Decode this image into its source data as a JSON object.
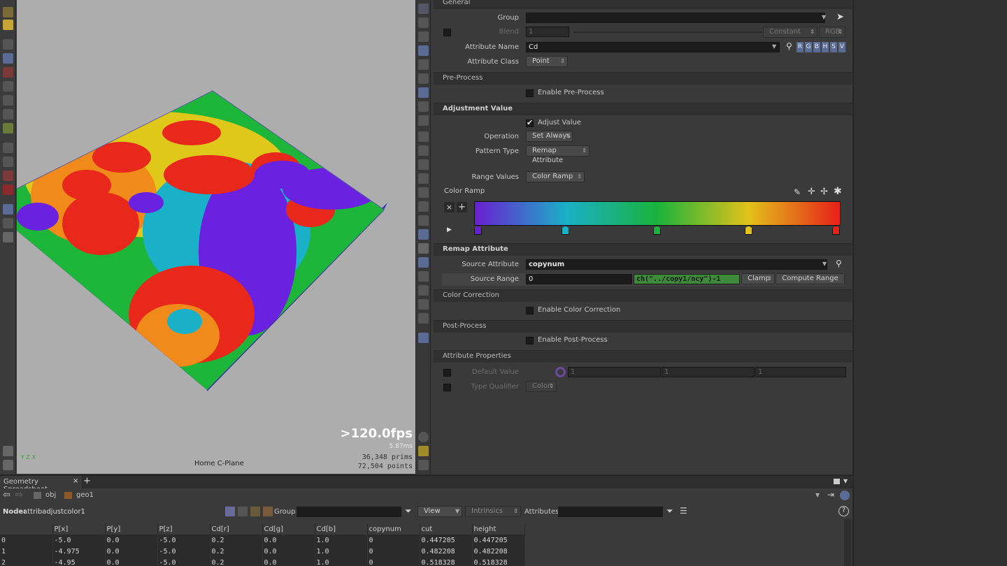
{
  "viewport": {
    "fps": ">120.0fps",
    "ms": "5.87ms",
    "prims_count": "36,348",
    "prims_label": "prims",
    "points_count": "72,504",
    "points_label": "points",
    "cplane": "Home C-Plane",
    "axis_label": "Y Z X"
  },
  "params": {
    "general": {
      "title": "General",
      "group_label": "Group",
      "group_value": "",
      "blend_label": "Blend",
      "blend_value": "1",
      "blend_mode": "Constant",
      "blend_space": "RGB",
      "attr_name_label": "Attribute Name",
      "attr_name_value": "Cd",
      "rgb_buttons": [
        "R",
        "G",
        "B",
        "H",
        "S",
        "V"
      ],
      "attr_class_label": "Attribute Class",
      "attr_class_value": "Point"
    },
    "preprocess": {
      "title": "Pre-Process",
      "enable_label": "Enable Pre-Process"
    },
    "adjustment": {
      "title": "Adjustment Value",
      "adjust_label": "Adjust Value",
      "operation_label": "Operation",
      "operation_value": "Set Always",
      "pattern_label": "Pattern Type",
      "pattern_value": "Remap Attribute",
      "range_label": "Range Values",
      "range_value": "Color Ramp",
      "ramp_label": "Color Ramp",
      "ramp_keys": [
        {
          "pos": 0.0,
          "color": "#6a1fd1"
        },
        {
          "pos": 0.25,
          "color": "#1ab0c8"
        },
        {
          "pos": 0.5,
          "color": "#19b33c"
        },
        {
          "pos": 0.75,
          "color": "#e2c21b"
        },
        {
          "pos": 1.0,
          "color": "#e8201a"
        }
      ]
    },
    "remap": {
      "title": "Remap Attribute",
      "source_attr_label": "Source Attribute",
      "source_attr_value": "copynum",
      "source_range_label": "Source Range",
      "source_range_min": "0",
      "source_range_max": "ch(\"../copy1/ncy\")-1",
      "clamp_value": "Clamp",
      "compute_label": "Compute Range"
    },
    "colorcorr": {
      "title": "Color Correction",
      "enable_label": "Enable Color Correction"
    },
    "postprocess": {
      "title": "Post-Process",
      "enable_label": "Enable Post-Process"
    },
    "attrprops": {
      "title": "Attribute Properties",
      "default_label": "Default Value",
      "default_values": [
        "1",
        "1",
        "1"
      ],
      "type_label": "Type Qualifier",
      "type_value": "Color"
    }
  },
  "spreadsheet": {
    "tab_label": "Geometry Spreadsheet",
    "path_obj": "obj",
    "path_geo": "geo1",
    "node_label": "Node:",
    "node_name": "attribadjustcolor1",
    "group_label": "Group:",
    "view_label": "View",
    "intrinsics_label": "Intrinsics",
    "attributes_label": "Attributes:",
    "columns": [
      "",
      "P[x]",
      "P[y]",
      "P[z]",
      "Cd[r]",
      "Cd[g]",
      "Cd[b]",
      "copynum",
      "cut",
      "height"
    ],
    "rows": [
      [
        "0",
        "-5.0",
        "0.0",
        "-5.0",
        "0.2",
        "0.0",
        "1.0",
        "0",
        "0.447205",
        "0.447205"
      ],
      [
        "1",
        "-4.975",
        "0.0",
        "-5.0",
        "0.2",
        "0.0",
        "1.0",
        "0",
        "0.482208",
        "0.482208"
      ],
      [
        "2",
        "-4.95",
        "0.0",
        "-5.0",
        "0.2",
        "0.0",
        "1.0",
        "0",
        "0.518328",
        "0.518328"
      ]
    ]
  },
  "colors": {
    "accent_rgb": "#5a6c94",
    "expr_green": "#3c8a3a"
  }
}
